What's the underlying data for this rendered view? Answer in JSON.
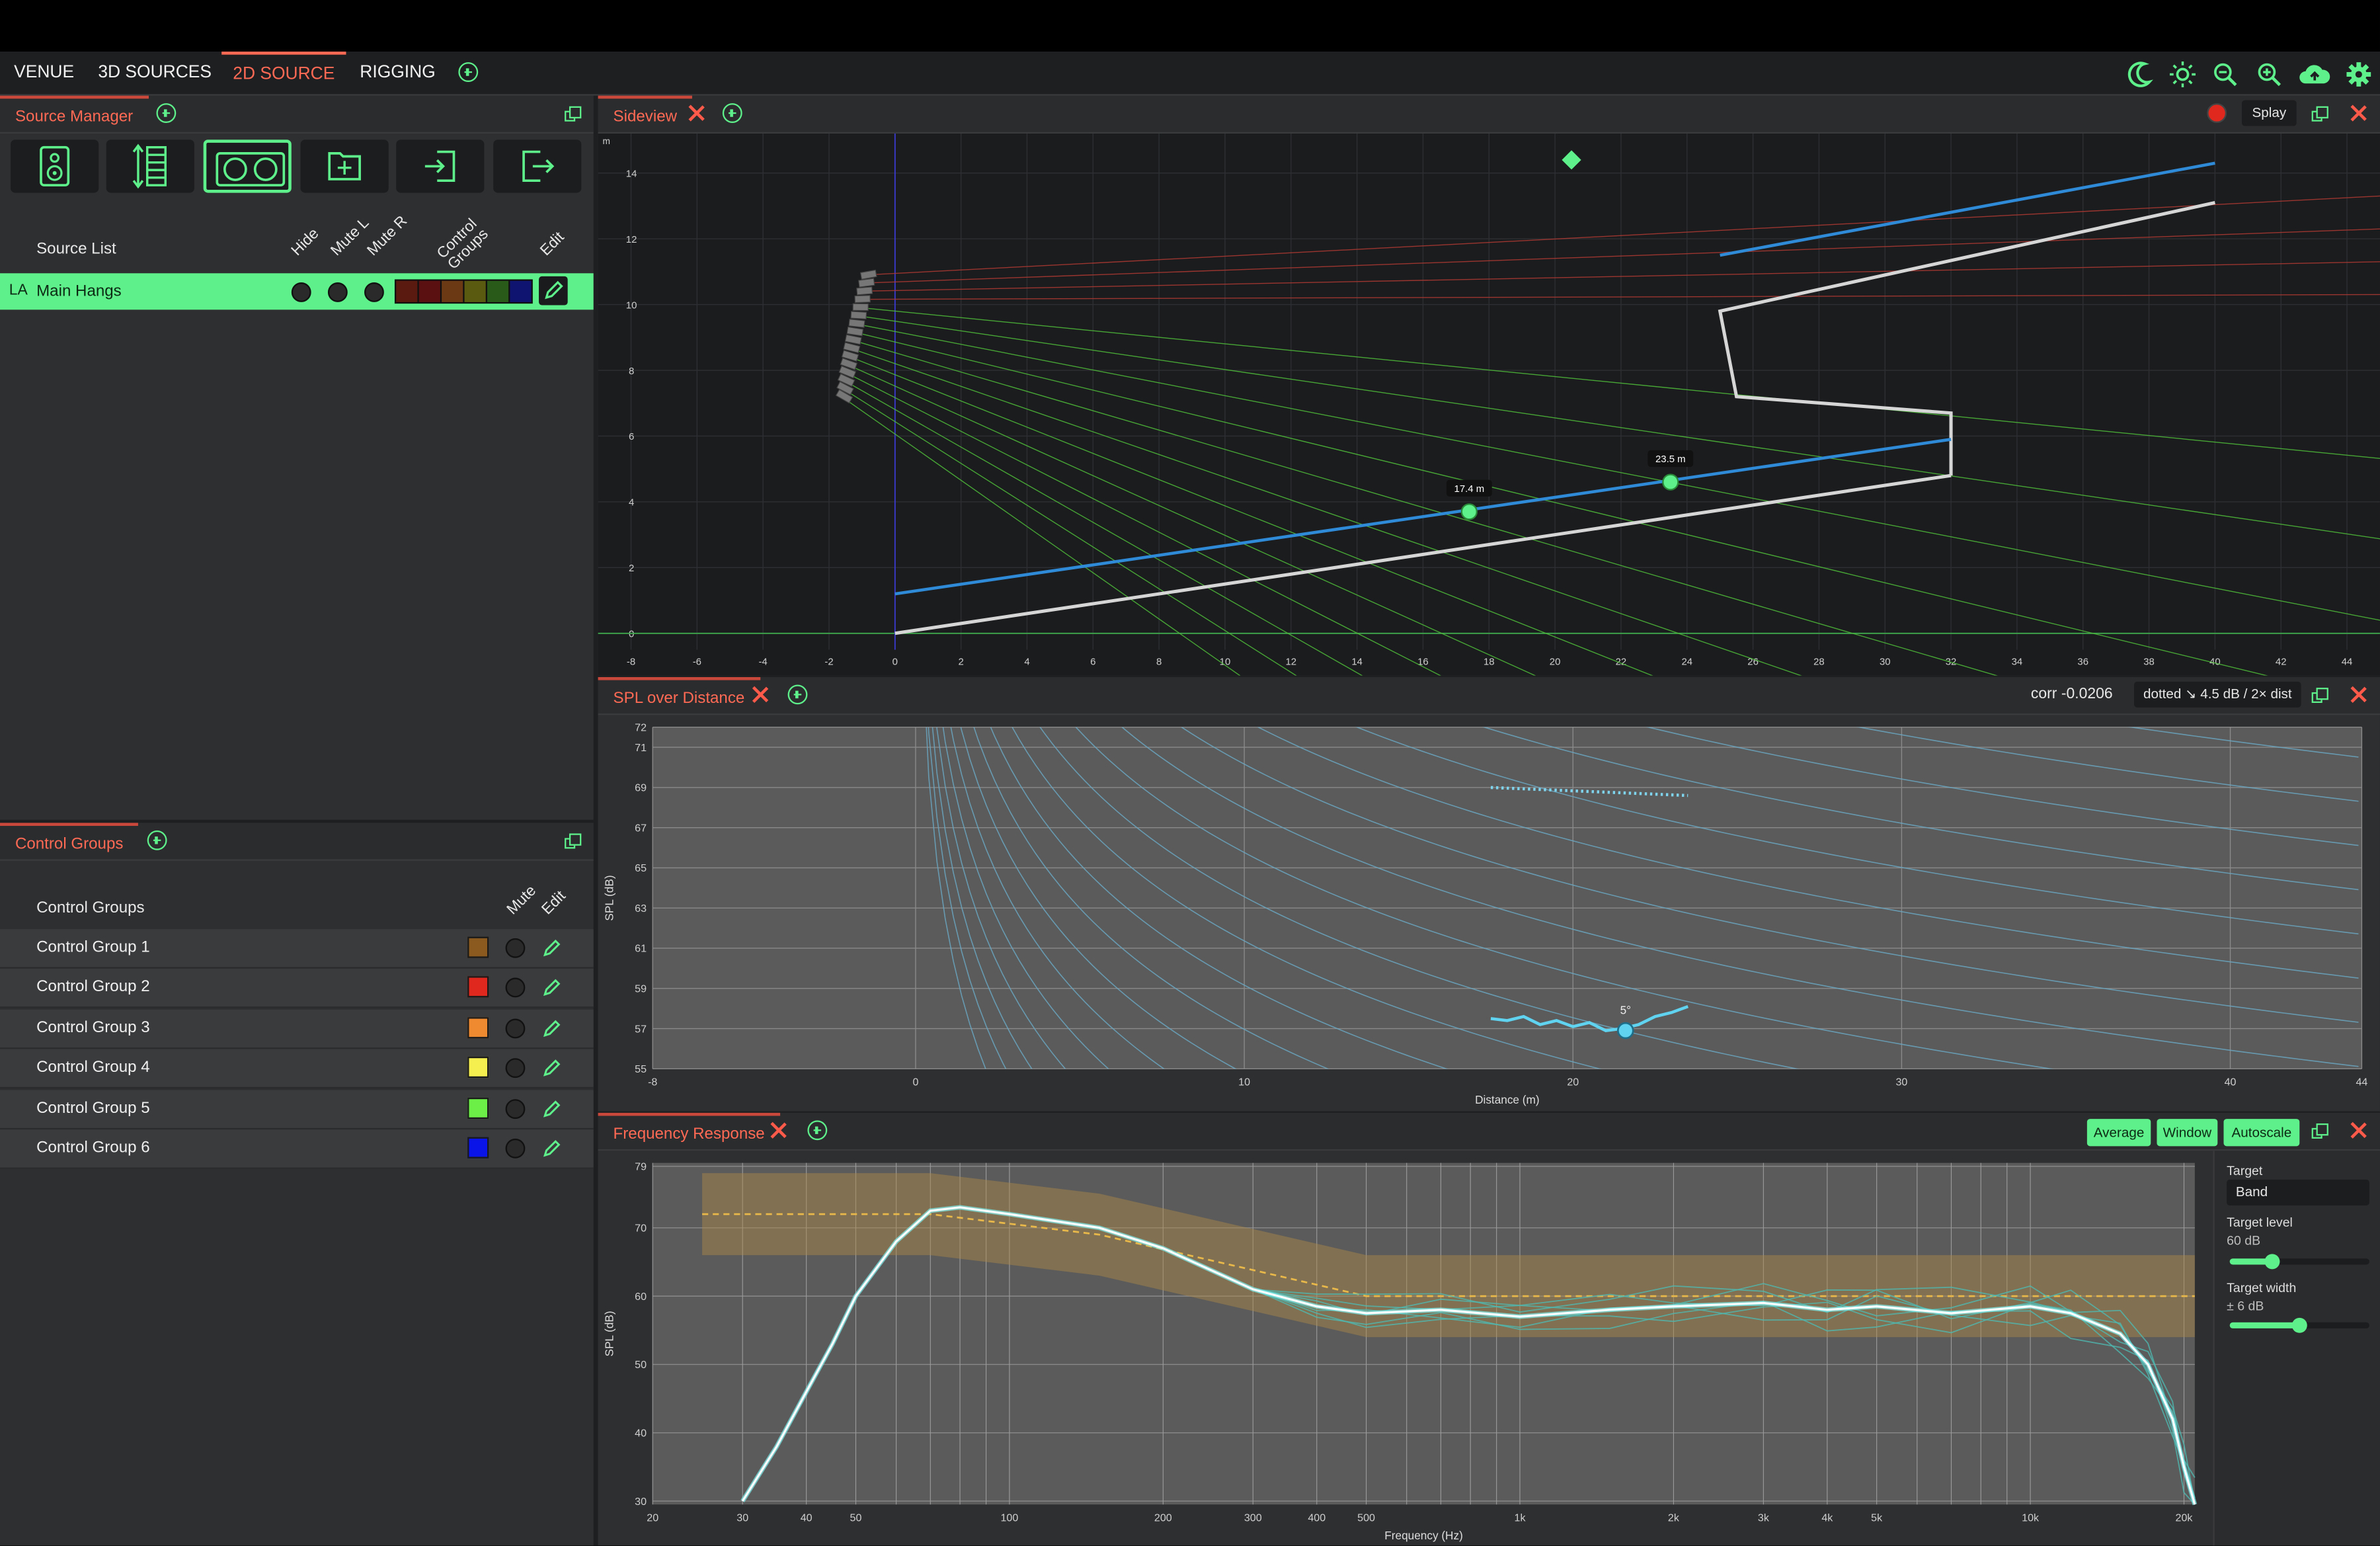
{
  "tabs": [
    {
      "label": "VENUE",
      "active": false
    },
    {
      "label": "3D SOURCES",
      "active": false
    },
    {
      "label": "2D SOURCE",
      "active": true
    },
    {
      "label": "RIGGING",
      "active": false
    }
  ],
  "toolbar_icons": [
    "moon-icon",
    "sun-icon",
    "zoom-out-icon",
    "zoom-in-icon",
    "cloud-upload-icon",
    "gear-icon"
  ],
  "source_manager": {
    "title": "Source Manager",
    "tool_icons": [
      "speaker-icon",
      "line-array-icon",
      "subwoofer-pair-icon",
      "new-folder-icon",
      "import-icon",
      "export-icon"
    ],
    "list_header": "Source List",
    "col_headers": {
      "hide": "Hide",
      "mute_l": "Mute L",
      "mute_r": "Mute R",
      "control_groups": "Control Groups",
      "edit": "Edit"
    },
    "sources": [
      {
        "type": "LA",
        "name": "Main Hangs",
        "group_colors": [
          "#5a1a0f",
          "#5a1010",
          "#6b3a14",
          "#5a5a10",
          "#2a5a1a",
          "#0f1470"
        ]
      }
    ]
  },
  "control_groups": {
    "title": "Control Groups",
    "list_header": "Control Groups",
    "col_headers": {
      "mute": "Mute",
      "edit": "Edit"
    },
    "groups": [
      {
        "name": "Control Group 1",
        "color": "#8a5a1e"
      },
      {
        "name": "Control Group 2",
        "color": "#e0281e"
      },
      {
        "name": "Control Group 3",
        "color": "#f08a30"
      },
      {
        "name": "Control Group 4",
        "color": "#f5f050"
      },
      {
        "name": "Control Group 5",
        "color": "#6cf048"
      },
      {
        "name": "Control Group 6",
        "color": "#0a14e8"
      }
    ]
  },
  "sideview": {
    "title": "Sideview",
    "splay_label": "Splay",
    "unit_label": "m"
  },
  "spl": {
    "title": "SPL over Distance",
    "corr": "corr -0.0206",
    "dotted_label": "dotted ↘ 4.5 dB / 2× dist"
  },
  "freq": {
    "title": "Frequency Response",
    "buttons": {
      "average": "Average",
      "window": "Window",
      "autoscale": "Autoscale"
    },
    "target": {
      "label": "Target",
      "mode": "Band",
      "level_label": "Target level",
      "level_value": "60 dB",
      "level_fraction": 0.3,
      "width_label": "Target width",
      "width_value": "± 6 dB",
      "width_fraction": 0.5
    }
  },
  "chart_data": [
    {
      "id": "sideview",
      "type": "scatter",
      "title": "",
      "xlabel": "",
      "ylabel": "m",
      "xlim": [
        -9,
        45
      ],
      "ylim": [
        -0.5,
        15.2
      ],
      "xticks": [
        -8,
        -6,
        -4,
        -2,
        0,
        2,
        4,
        6,
        8,
        10,
        12,
        14,
        16,
        18,
        20,
        22,
        24,
        26,
        28,
        30,
        32,
        34,
        36,
        38,
        40,
        42,
        44
      ],
      "yticks": [
        0,
        2,
        4,
        6,
        8,
        10,
        12,
        14
      ],
      "venue_floor": [
        [
          0,
          0
        ],
        [
          32,
          4.8
        ]
      ],
      "venue_profile": [
        [
          32,
          4.8
        ],
        [
          32,
          6.7
        ],
        [
          25.5,
          7.2
        ],
        [
          25,
          9.8
        ],
        [
          40,
          13.1
        ]
      ],
      "listener_planes": [
        {
          "x": [
            0,
            32
          ],
          "y": [
            1.2,
            5.9
          ]
        },
        {
          "x": [
            25,
            40
          ],
          "y": [
            11.5,
            14.3
          ]
        }
      ],
      "array": {
        "top": [
          -0.8,
          10.9
        ],
        "bottom": [
          -1.3,
          7.2
        ]
      },
      "markers": [
        {
          "x": 17.4,
          "y": 3.7,
          "label": "17.4 m"
        },
        {
          "x": 23.5,
          "y": 4.6,
          "label": "23.5 m"
        }
      ],
      "diamond": {
        "x": 20.5,
        "y": 14.4
      }
    },
    {
      "id": "spl_over_distance",
      "type": "line",
      "title": "",
      "xlabel": "Distance (m)",
      "ylabel": "SPL (dB)",
      "xlim": [
        -8,
        44
      ],
      "ylim": [
        55,
        72
      ],
      "xticks": [
        -8,
        0,
        10,
        20,
        30,
        40,
        44
      ],
      "yticks": [
        55,
        57,
        59,
        61,
        63,
        65,
        67,
        69,
        71,
        72
      ],
      "series": [
        {
          "x": [
            17.5,
            18,
            18.5,
            19,
            19.5,
            20,
            20.5,
            21,
            21.5,
            22,
            22.5,
            23,
            23.5
          ],
          "y": [
            57.5,
            57.4,
            57.6,
            57.2,
            57.4,
            57.1,
            57.3,
            56.9,
            57.0,
            57.2,
            57.6,
            57.8,
            58.1
          ]
        },
        {
          "x": [
            17.5,
            23.5
          ],
          "y": [
            69.0,
            68.6
          ]
        }
      ],
      "marker": {
        "x": 21.6,
        "y": 56.9,
        "label": "5°"
      }
    },
    {
      "id": "frequency_response",
      "type": "line",
      "title": "",
      "xlabel": "Frequency (Hz)",
      "ylabel": "SPL (dB)",
      "xscale": "log",
      "xlim": [
        20,
        21000
      ],
      "ylim": [
        29.5,
        79.5
      ],
      "xticks": [
        20,
        30,
        40,
        50,
        100,
        200,
        300,
        400,
        500,
        1000,
        2000,
        3000,
        4000,
        5000,
        10000,
        20000
      ],
      "xtick_labels": [
        "20",
        "30",
        "40",
        "50",
        "100",
        "200",
        "300",
        "400",
        "500",
        "1k",
        "2k",
        "3k",
        "4k",
        "5k",
        "10k",
        "20k"
      ],
      "yticks": [
        30,
        40,
        50,
        60,
        70,
        79
      ],
      "series": [
        {
          "x": [
            30,
            35,
            40,
            45,
            50,
            60,
            70,
            80,
            100,
            150,
            200,
            300,
            400,
            500,
            700,
            1000,
            1500,
            2000,
            3000,
            4000,
            5000,
            7000,
            10000,
            12000,
            15000,
            17000,
            19000,
            20000,
            21000
          ],
          "y": [
            30,
            38,
            46,
            53,
            60,
            68,
            72.5,
            73,
            72,
            70,
            67,
            61,
            58.5,
            57.5,
            58,
            57,
            58,
            58.5,
            59,
            58,
            58.5,
            57.5,
            58.5,
            57.5,
            54.5,
            50,
            42,
            35,
            29.5
          ]
        }
      ],
      "target_line": {
        "x": [
          25,
          70,
          150,
          500,
          21000
        ],
        "y": [
          72,
          72,
          69,
          60,
          60
        ]
      },
      "target_band_width": 6
    }
  ]
}
